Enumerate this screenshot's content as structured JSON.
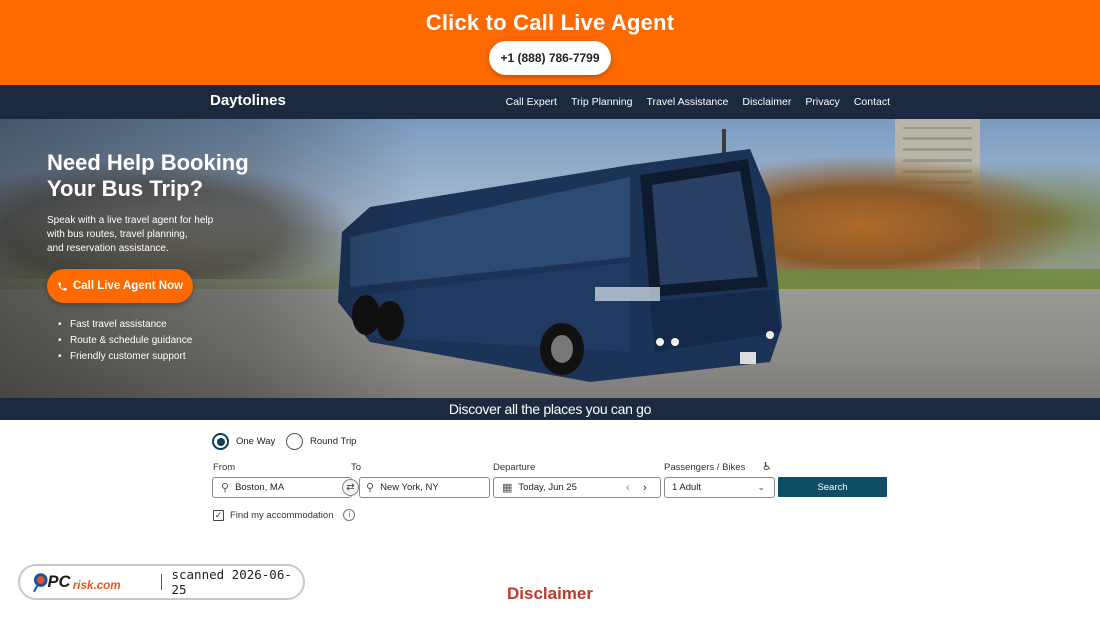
{
  "banner": {
    "title": "Click to Call Live Agent",
    "phone": "+1 (888) 786-7799"
  },
  "nav": {
    "brand": "Daytolines",
    "links": [
      "Call Expert",
      "Trip Planning",
      "Travel Assistance",
      "Disclaimer",
      "Privacy",
      "Contact"
    ]
  },
  "hero": {
    "heading_line1": "Need Help Booking",
    "heading_line2": "Your Bus Trip?",
    "description_line1": "Speak with a live travel agent for help",
    "description_line2": "with bus routes, travel planning,",
    "description_line3": "and reservation assistance.",
    "cta_label": "Call Live Agent Now",
    "features": [
      "Fast travel assistance",
      "Route & schedule guidance",
      "Friendly customer support"
    ]
  },
  "discover": "Discover all the places you can go",
  "search": {
    "trip_types": [
      "One Way",
      "Round Trip"
    ],
    "selected_trip": "One Way",
    "from_label": "From",
    "from_value": "Boston, MA",
    "to_label": "To",
    "to_value": "New York, NY",
    "departure_label": "Departure",
    "departure_value": "Today, Jun 25",
    "passengers_label": "Passengers / Bikes",
    "passengers_value": "1 Adult",
    "search_label": "Search",
    "accommodation_label": "Find my accommodation",
    "accommodation_checked": true
  },
  "watermark": {
    "brand": "PCrisk.com",
    "stamp": "scanned 2026-06-25"
  },
  "footer_heading": "Disclaimer",
  "colors": {
    "accent": "#ff6a00",
    "navy": "#1b2a3f",
    "search_button": "#0f4d66",
    "disclaimer": "#c0392b"
  }
}
